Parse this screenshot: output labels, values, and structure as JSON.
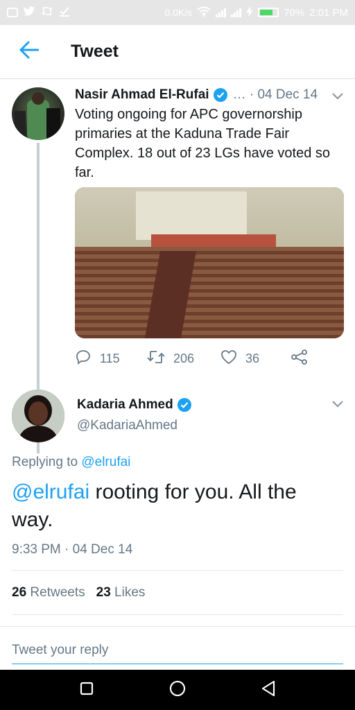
{
  "status_bar": {
    "net_speed": "0.0K/s",
    "battery": "70%",
    "battery_level": 0.7,
    "time": "2:01 PM",
    "icons": [
      "instagram-icon",
      "twitter-icon",
      "retweet-icon",
      "download-check-icon",
      "wifi-icon",
      "signal-icon",
      "charging-icon",
      "battery-icon"
    ]
  },
  "header": {
    "back_icon": "arrow-left-icon",
    "title": "Tweet"
  },
  "parent_tweet": {
    "author_name": "Nasir Ahmad El-Rufai",
    "verified": true,
    "meta": "… · 04 Dec 14",
    "text": "Voting ongoing for APC governorship primaries at the Kaduna Trade Fair Complex. 18 out of 23 LGs have voted so far.",
    "media_icon": "auditorium-photo",
    "actions": {
      "replies": "115",
      "retweets": "206",
      "likes": "36"
    }
  },
  "reply_tweet": {
    "author_name": "Kadaria Ahmed",
    "verified": true,
    "handle": "@KadariaAhmed",
    "replying_prefix": "Replying to",
    "replying_to": "@elrufai",
    "mention": "@elrufai",
    "text": " rooting for you. All the way.",
    "timestamp": "9:33 PM · 04 Dec 14",
    "retweets_count": "26",
    "retweets_label": "Retweets",
    "likes_count": "23",
    "likes_label": "Likes"
  },
  "reply_box": {
    "placeholder": "Tweet your reply"
  },
  "colors": {
    "accent": "#1da1f2",
    "secondary_text": "#657786",
    "primary_text": "#14171a"
  }
}
